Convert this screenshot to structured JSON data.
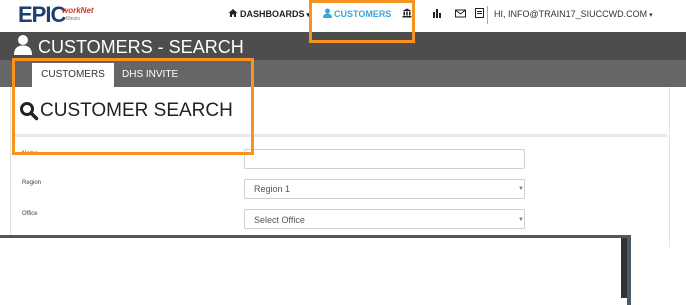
{
  "nav": {
    "logo_text": "EPIC",
    "logo_sub": "workNet",
    "logo_small": "Illinois",
    "dashboards": "DASHBOARDS",
    "customers": "CUSTOMERS",
    "user": "HI, INFO@TRAIN17_SIUCCWD.COM"
  },
  "page": {
    "title": "CUSTOMERS - SEARCH"
  },
  "tabs": [
    {
      "label": "CUSTOMERS"
    },
    {
      "label": "DHS INVITE"
    }
  ],
  "search": {
    "heading": "CUSTOMER SEARCH"
  },
  "form": {
    "name_label": "Name",
    "region_label": "Region",
    "region_value": "Region 1",
    "office_label": "Office",
    "office_value": "Select Office"
  },
  "colors": {
    "accent": "#f7931e",
    "nav_active": "#3aa7d4",
    "title_bar": "#4d4d4d",
    "tab_bar": "#666666"
  }
}
